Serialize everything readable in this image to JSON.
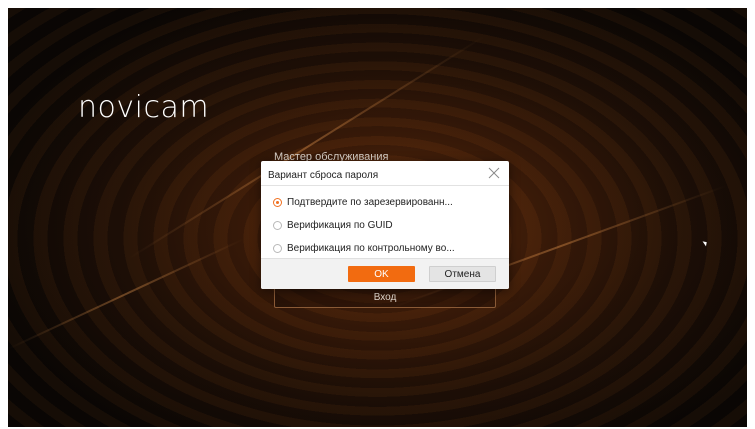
{
  "brand": {
    "logo_text": "novicam"
  },
  "login_page": {
    "master_label": "Мастер обслуживания",
    "login_button": "Вход"
  },
  "dialog": {
    "title": "Вариант сброса пароля",
    "close_icon": "close-icon",
    "options": [
      {
        "label": "Подтвердите по зарезервированн...",
        "checked": true
      },
      {
        "label": "Верификация по GUID",
        "checked": false
      },
      {
        "label": "Верификация по контрольному во...",
        "checked": false
      }
    ],
    "ok_label": "OK",
    "cancel_label": "Отмена"
  },
  "colors": {
    "accent": "#f26b10",
    "background": "#1e0f06"
  }
}
